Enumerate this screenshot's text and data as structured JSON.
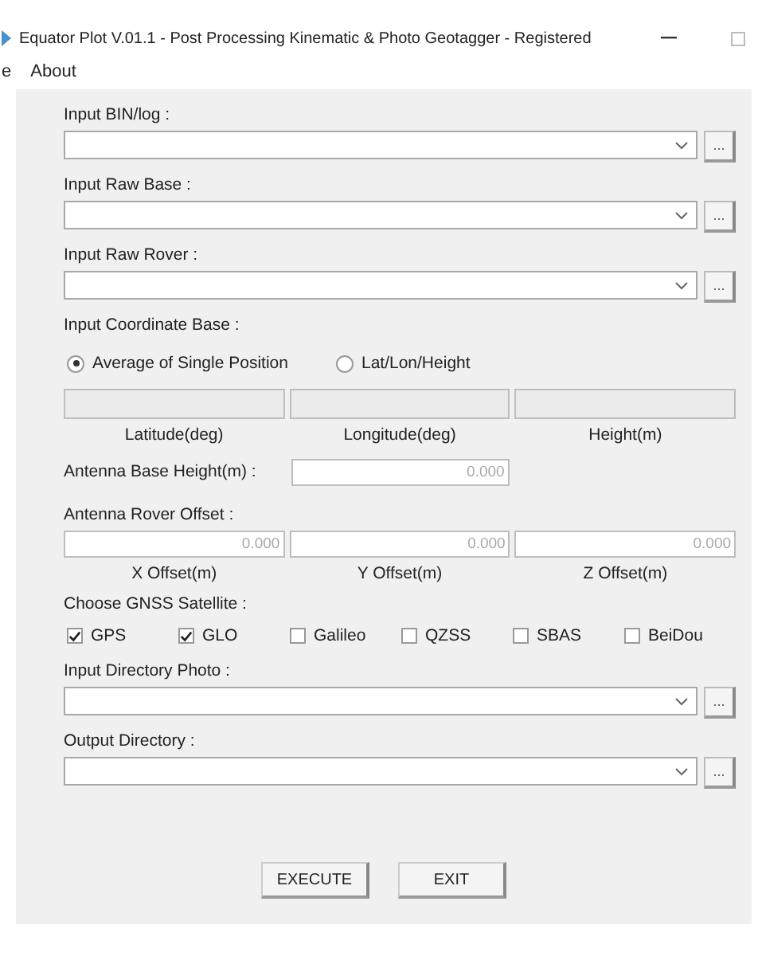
{
  "window": {
    "title": "Equator Plot V.01.1 - Post Processing Kinematic & Photo Geotagger - Registered"
  },
  "menu": [
    {
      "label": "e"
    },
    {
      "label": "About"
    }
  ],
  "file_inputs_top": [
    {
      "label": "Input BIN/log :",
      "browse": "..."
    },
    {
      "label": "Input Raw Base :",
      "browse": "..."
    },
    {
      "label": "Input Raw Rover :",
      "browse": "..."
    }
  ],
  "coordinate_base": {
    "label": "Input Coordinate Base :",
    "options": [
      {
        "label": "Average of Single Position",
        "selected": true
      },
      {
        "label": "Lat/Lon/Height",
        "selected": false
      }
    ],
    "fields": [
      {
        "caption": "Latitude(deg)",
        "disabled": true
      },
      {
        "caption": "Longitude(deg)",
        "disabled": true
      },
      {
        "caption": "Height(m)",
        "disabled": true
      }
    ]
  },
  "antenna_base_height": {
    "label": "Antenna Base Height(m) :",
    "value": "0.000"
  },
  "antenna_rover_offset": {
    "label": "Antenna Rover Offset :",
    "fields": [
      {
        "value": "0.000",
        "caption": "X Offset(m)"
      },
      {
        "value": "0.000",
        "caption": "Y Offset(m)"
      },
      {
        "value": "0.000",
        "caption": "Z Offset(m)"
      }
    ]
  },
  "gnss": {
    "label": "Choose GNSS Satellite :",
    "satellites": [
      {
        "label": "GPS",
        "checked": true
      },
      {
        "label": "GLO",
        "checked": true
      },
      {
        "label": "Galileo",
        "checked": false
      },
      {
        "label": "QZSS",
        "checked": false
      },
      {
        "label": "SBAS",
        "checked": false
      },
      {
        "label": "BeiDou",
        "checked": false
      }
    ]
  },
  "file_inputs_bottom": [
    {
      "label": "Input Directory Photo :",
      "browse": "..."
    },
    {
      "label": "Output Directory :",
      "browse": "..."
    }
  ],
  "buttons": [
    "EXECUTE",
    "EXIT"
  ]
}
